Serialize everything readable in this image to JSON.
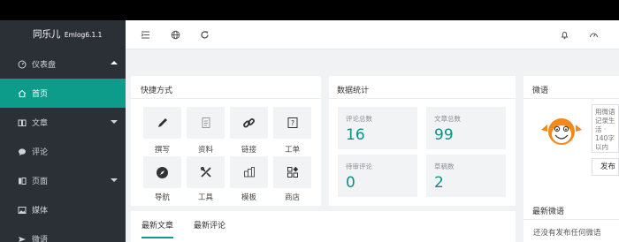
{
  "brand": {
    "name": "同乐儿",
    "version": "Emlog6.1.1"
  },
  "sidebar": {
    "items": [
      {
        "label": "仪表盘",
        "icon": "dashboard-icon"
      },
      {
        "label": "首页",
        "icon": "home-icon"
      },
      {
        "label": "文章",
        "icon": "article-icon"
      },
      {
        "label": "评论",
        "icon": "comment-icon"
      },
      {
        "label": "页面",
        "icon": "page-icon"
      },
      {
        "label": "媒体",
        "icon": "media-icon"
      },
      {
        "label": "微语",
        "icon": "twitter-icon"
      }
    ]
  },
  "header": {
    "icons": [
      "menu-toggle-icon",
      "globe-icon",
      "refresh-icon",
      "bell-icon",
      "speed-icon"
    ]
  },
  "shortcuts": {
    "title": "快捷方式",
    "items": [
      {
        "label": "撰写",
        "icon": "pencil-icon"
      },
      {
        "label": "资料",
        "icon": "document-icon"
      },
      {
        "label": "链接",
        "icon": "link-icon"
      },
      {
        "label": "工单",
        "icon": "ticket-icon"
      },
      {
        "label": "导航",
        "icon": "compass-icon"
      },
      {
        "label": "工具",
        "icon": "tools-icon"
      },
      {
        "label": "模板",
        "icon": "template-icon"
      },
      {
        "label": "商店",
        "icon": "store-icon"
      }
    ]
  },
  "stats": {
    "title": "数据统计",
    "items": [
      {
        "label": "评论总数",
        "value": "16"
      },
      {
        "label": "文章总数",
        "value": "99"
      },
      {
        "label": "待审评论",
        "value": "0"
      },
      {
        "label": "草稿数",
        "value": "2"
      }
    ]
  },
  "weiyu": {
    "title": "微语",
    "placeholder": "用微语记录生活 · 140字以内",
    "submit_label": "发布"
  },
  "latest_weiyu": {
    "title": "最新微语",
    "empty_text": "还没有发布任何微语"
  },
  "tabs": [
    {
      "label": "最新文章"
    },
    {
      "label": "最新评论"
    }
  ],
  "colors": {
    "accent": "#0d9b8a",
    "sidebar_bg": "#2b2f36",
    "stat_value": "#0d8f86"
  }
}
